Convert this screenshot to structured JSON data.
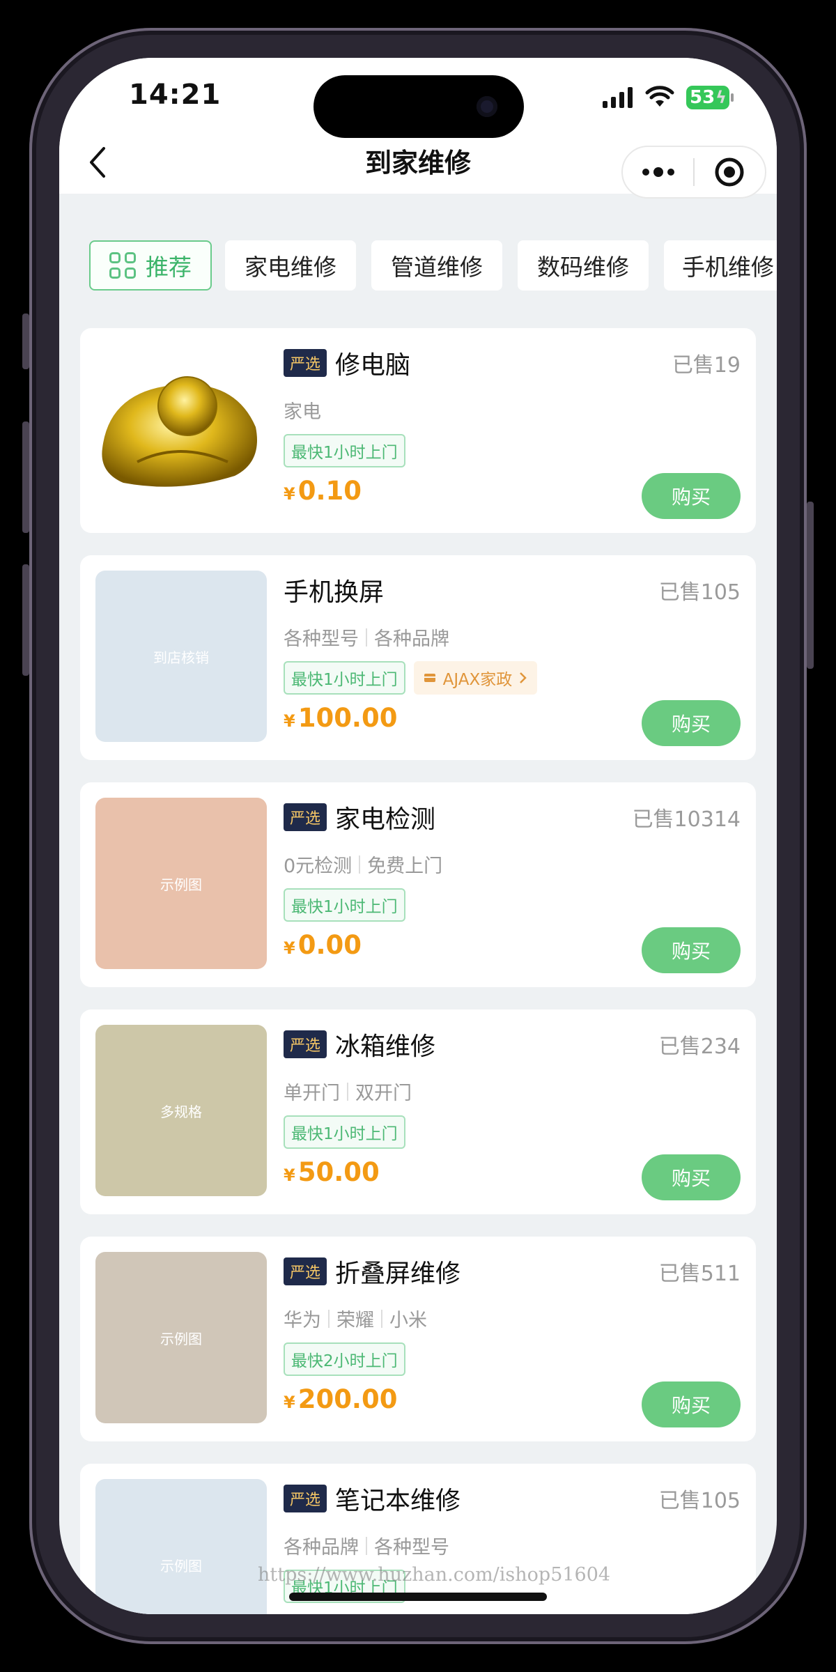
{
  "status_bar": {
    "time": "14:21",
    "battery": "53"
  },
  "nav": {
    "title": "到家维修"
  },
  "tabs": [
    {
      "label": "推荐",
      "active": true
    },
    {
      "label": "家电维修"
    },
    {
      "label": "管道维修"
    },
    {
      "label": "数码维修"
    },
    {
      "label": "手机维修"
    }
  ],
  "products": [
    {
      "badge": "严选",
      "title": "修电脑",
      "sold": "已售19",
      "specs": [
        "家电"
      ],
      "tag": "最快1小时上门",
      "shop": "",
      "currency": "¥",
      "price": "0.10",
      "buy": "购买",
      "thumb_text": "",
      "thumb_color": "#d8b420"
    },
    {
      "badge": "",
      "title": "手机换屏",
      "sold": "已售105",
      "specs": [
        "各种型号",
        "各种品牌"
      ],
      "tag": "最快1小时上门",
      "shop": "AJAX家政",
      "currency": "¥",
      "price": "100.00",
      "buy": "购买",
      "thumb_text": "到店核销",
      "thumb_color": "#dce6ee"
    },
    {
      "badge": "严选",
      "title": "家电检测",
      "sold": "已售10314",
      "specs": [
        "0元检测",
        "免费上门"
      ],
      "tag": "最快1小时上门",
      "shop": "",
      "currency": "¥",
      "price": "0.00",
      "buy": "购买",
      "thumb_text": "示例图",
      "thumb_color": "#e9c1ab"
    },
    {
      "badge": "严选",
      "title": "冰箱维修",
      "sold": "已售234",
      "specs": [
        "单开门",
        "双开门"
      ],
      "tag": "最快1小时上门",
      "shop": "",
      "currency": "¥",
      "price": "50.00",
      "buy": "购买",
      "thumb_text": "多规格",
      "thumb_color": "#cdc7a8"
    },
    {
      "badge": "严选",
      "title": "折叠屏维修",
      "sold": "已售511",
      "specs": [
        "华为",
        "荣耀",
        "小米"
      ],
      "tag": "最快2小时上门",
      "shop": "",
      "currency": "¥",
      "price": "200.00",
      "buy": "购买",
      "thumb_text": "示例图",
      "thumb_color": "#d0c6b8"
    },
    {
      "badge": "严选",
      "title": "笔记本维修",
      "sold": "已售105",
      "specs": [
        "各种品牌",
        "各种型号"
      ],
      "tag": "最快1小时上门",
      "shop": "",
      "currency": "¥",
      "price": "",
      "buy": "",
      "thumb_text": "示例图",
      "thumb_color": "#dce6ee"
    }
  ],
  "watermark": "https://www.huzhan.com/ishop51604"
}
